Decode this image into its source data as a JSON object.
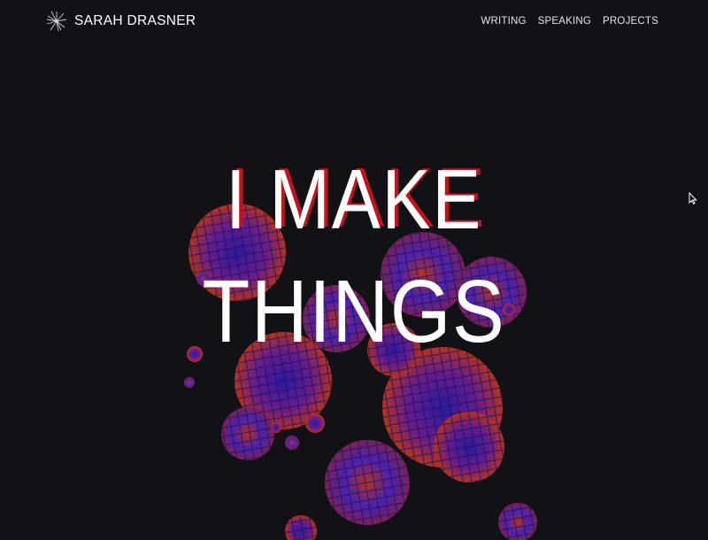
{
  "header": {
    "brand_name": "SARAH DRASNER",
    "nav": [
      "WRITING",
      "SPEAKING",
      "PROJECTS"
    ]
  },
  "hero": {
    "line1": "I MAKE",
    "line2": "THINGS"
  },
  "colors": {
    "background": "#111116",
    "text": "#ffffff",
    "accent_red": "#c1121f",
    "flower_blue": "#3a1fb8",
    "flower_red": "#c0321a"
  },
  "icons": {
    "logo": "dandelion-icon",
    "cursor": "mouse-pointer-icon"
  }
}
